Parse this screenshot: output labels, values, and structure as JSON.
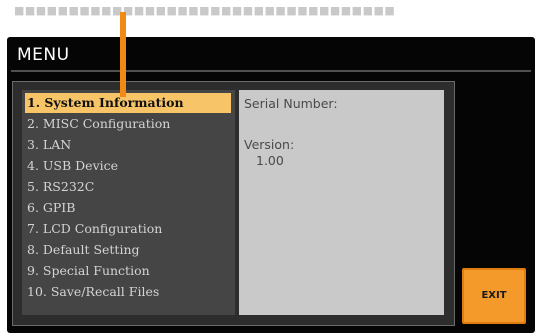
{
  "screen": {
    "title": "MENU"
  },
  "menu": {
    "items": [
      {
        "label": "1. System Information",
        "selected": true
      },
      {
        "label": "2. MISC Configuration",
        "selected": false
      },
      {
        "label": "3. LAN",
        "selected": false
      },
      {
        "label": "4. USB Device",
        "selected": false
      },
      {
        "label": "5. RS232C",
        "selected": false
      },
      {
        "label": "6. GPIB",
        "selected": false
      },
      {
        "label": "7. LCD Configuration",
        "selected": false
      },
      {
        "label": "8. Default Setting",
        "selected": false
      },
      {
        "label": "9. Special Function",
        "selected": false
      },
      {
        "label": "10. Save/Recall Files",
        "selected": false
      }
    ]
  },
  "info": {
    "serial_label": "Serial Number:",
    "version_label": "Version:",
    "version_value": "1.00"
  },
  "buttons": {
    "exit_label": "EXIT"
  },
  "colors": {
    "highlight": "#f7c568",
    "pointer": "#f08a14",
    "exit_button": "#f39a2a",
    "screen_background": "#050505",
    "info_panel": "#c9c9c9"
  }
}
